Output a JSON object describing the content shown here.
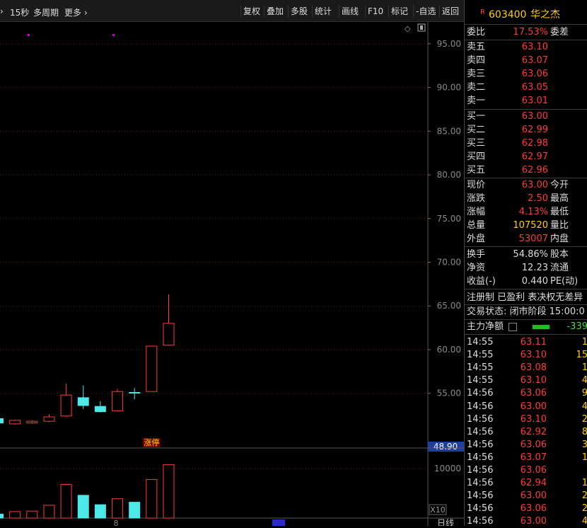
{
  "toolbar": {
    "left_items": [
      "15秒",
      "多周期",
      "更多 ›"
    ],
    "buttons": [
      "复权",
      "叠加",
      "多股",
      "统计",
      "画线",
      "F10",
      "标记",
      "-自选",
      "返回"
    ]
  },
  "chart_data": {
    "type": "candlestick",
    "y_ticks": [
      "95.00",
      "90.00",
      "85.00",
      "80.00",
      "75.00",
      "70.00",
      "65.00",
      "60.00",
      "55.00"
    ],
    "price_range": [
      48.9,
      97.5
    ],
    "current_price_label": "48.90",
    "limit_up_label": "涨停",
    "candles": [
      {
        "open": 51.6,
        "close": 52.1,
        "high": 52.3,
        "low": 51.4,
        "up": false
      },
      {
        "open": 51.5,
        "close": 51.9,
        "high": 52.0,
        "low": 51.4,
        "up": true
      },
      {
        "open": 51.6,
        "close": 51.8,
        "high": 51.9,
        "low": 51.5,
        "up": true
      },
      {
        "open": 51.8,
        "close": 52.3,
        "high": 52.6,
        "low": 51.7,
        "up": true
      },
      {
        "open": 52.4,
        "close": 54.8,
        "high": 56.1,
        "low": 52.3,
        "up": true
      },
      {
        "open": 54.5,
        "close": 53.6,
        "high": 55.9,
        "low": 53.2,
        "up": false
      },
      {
        "open": 53.5,
        "close": 52.9,
        "high": 54.1,
        "low": 52.8,
        "up": false
      },
      {
        "open": 53.0,
        "close": 55.2,
        "high": 55.5,
        "low": 52.9,
        "up": true
      },
      {
        "open": 55.1,
        "close": 55.1,
        "high": 55.6,
        "low": 54.3,
        "up": false
      },
      {
        "open": 55.2,
        "close": 60.4,
        "high": 60.4,
        "low": 55.2,
        "up": true
      },
      {
        "open": 60.5,
        "close": 63.0,
        "high": 66.3,
        "low": 60.5,
        "up": true
      }
    ],
    "volume_tick": "10000",
    "volume_unit": "X10",
    "volume_max": 13000,
    "volumes": [
      800,
      1300,
      1400,
      2600,
      6800,
      4600,
      2700,
      3900,
      3200,
      7800,
      10800
    ],
    "x_label": "8",
    "footer_label": "日线",
    "colors": {
      "up": "#ff3b3b",
      "down": "#4de8e8",
      "grid": "#5a1a1a",
      "axis": "#8a8a8a"
    }
  },
  "quote": {
    "badge": "R",
    "code": "603400",
    "name": "华之杰",
    "weibi_label": "委比",
    "weibi_value": "17.53%",
    "weicha_label": "委差",
    "asks": [
      {
        "label": "卖五",
        "price": "63.10"
      },
      {
        "label": "卖四",
        "price": "63.07"
      },
      {
        "label": "卖三",
        "price": "63.06"
      },
      {
        "label": "卖二",
        "price": "63.05"
      },
      {
        "label": "卖一",
        "price": "63.01"
      }
    ],
    "bids": [
      {
        "label": "买一",
        "price": "63.00"
      },
      {
        "label": "买二",
        "price": "62.99"
      },
      {
        "label": "买三",
        "price": "62.98"
      },
      {
        "label": "买四",
        "price": "62.97"
      },
      {
        "label": "买五",
        "price": "62.96"
      }
    ],
    "stats": [
      {
        "label": "现价",
        "value": "63.00",
        "right": "今开"
      },
      {
        "label": "涨跌",
        "value": "2.50",
        "right": "最高"
      },
      {
        "label": "涨幅",
        "value": "4.13%",
        "right": "最低"
      },
      {
        "label": "总量",
        "value": "107520",
        "right": "量比"
      },
      {
        "label": "外盘",
        "value": "53007",
        "right": "内盘"
      }
    ],
    "stats2": [
      {
        "label": "换手",
        "value": "54.86%",
        "right": "股本"
      },
      {
        "label": "净资",
        "value": "12.23",
        "right": "流通"
      },
      {
        "label": "收益(-)",
        "value": "0.440",
        "right": "PE(动)"
      }
    ],
    "tags": "注册制 已盈利 表决权无差异",
    "trade_status": "交易状态: 闭市阶段 15:00:0",
    "main_flow_label": "主力净额",
    "main_flow_value": "-339",
    "ticks": [
      {
        "time": "14:55",
        "price": "63.11",
        "vol": "1"
      },
      {
        "time": "14:55",
        "price": "63.10",
        "vol": "15"
      },
      {
        "time": "14:55",
        "price": "63.08",
        "vol": "1"
      },
      {
        "time": "14:55",
        "price": "63.10",
        "vol": "4"
      },
      {
        "time": "14:56",
        "price": "63.06",
        "vol": "9"
      },
      {
        "time": "14:56",
        "price": "63.00",
        "vol": "4"
      },
      {
        "time": "14:56",
        "price": "63.10",
        "vol": "2"
      },
      {
        "time": "14:56",
        "price": "62.92",
        "vol": "8"
      },
      {
        "time": "14:56",
        "price": "63.06",
        "vol": "3"
      },
      {
        "time": "14:56",
        "price": "63.07",
        "vol": "1"
      },
      {
        "time": "14:56",
        "price": "63.06",
        "vol": ""
      },
      {
        "time": "14:56",
        "price": "62.94",
        "vol": "1"
      },
      {
        "time": "14:56",
        "price": "63.00",
        "vol": "2"
      },
      {
        "time": "14:56",
        "price": "63.06",
        "vol": "2"
      },
      {
        "time": "14:56",
        "price": "63.00",
        "vol": "4"
      }
    ]
  }
}
